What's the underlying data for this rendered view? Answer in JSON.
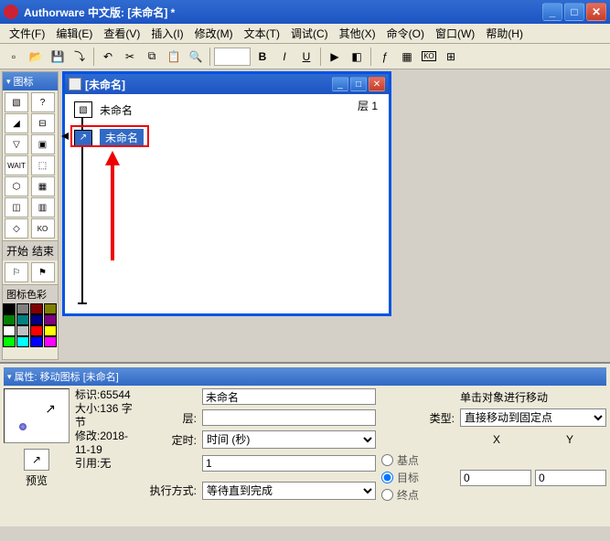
{
  "titlebar": {
    "text": "Authorware 中文版: [未命名] *"
  },
  "menu": [
    "文件(F)",
    "编辑(E)",
    "查看(V)",
    "插入(I)",
    "修改(M)",
    "文本(T)",
    "调试(C)",
    "其他(X)",
    "命令(O)",
    "窗口(W)",
    "帮助(H)"
  ],
  "toolbar_icons": [
    "new-file",
    "open-file",
    "save",
    "import",
    "undo",
    "cut",
    "copy",
    "paste",
    "find",
    "text-style",
    "bold",
    "italic",
    "underline",
    "run",
    "control-panel",
    "trace",
    "functions",
    "variables",
    "knowledge"
  ],
  "palette": {
    "title": "图标",
    "section_start_end": {
      "start": "开始",
      "end": "结束"
    },
    "color_label": "图标色彩",
    "colors": [
      "#000000",
      "#808080",
      "#800000",
      "#808000",
      "#008000",
      "#008080",
      "#000080",
      "#800080",
      "#ffffff",
      "#c0c0c0",
      "#ff0000",
      "#ffff00",
      "#00ff00",
      "#00ffff",
      "#0000ff",
      "#ff00ff"
    ]
  },
  "doc": {
    "title": "[未命名]",
    "layer_label": "层",
    "layer_value": "1",
    "node1_label": "未命名",
    "node2_label": "未命名"
  },
  "props": {
    "title": "属性: 移动图标 [未命名]",
    "meta": {
      "id_label": "标识:",
      "id_value": "65544",
      "size_label": "大小:",
      "size_value": "136 字节",
      "mod_label": "修改:",
      "mod_value": "2018-11-19",
      "ref_label": "引用:",
      "ref_value": "无"
    },
    "preview_label": "预览",
    "name_value": "未命名",
    "instruction": "单击对象进行移动",
    "layer_label": "层:",
    "layer_value": "",
    "type_label": "类型:",
    "type_value": "直接移动到固定点",
    "timing_label": "定时:",
    "timing_value": "时间 (秒)",
    "timing_num": "1",
    "exec_label": "执行方式:",
    "exec_value": "等待直到完成",
    "radios": {
      "base": "基点",
      "target": "目标",
      "end": "终点"
    },
    "x_label": "X",
    "y_label": "Y",
    "x_value": "0",
    "y_value": "0"
  }
}
